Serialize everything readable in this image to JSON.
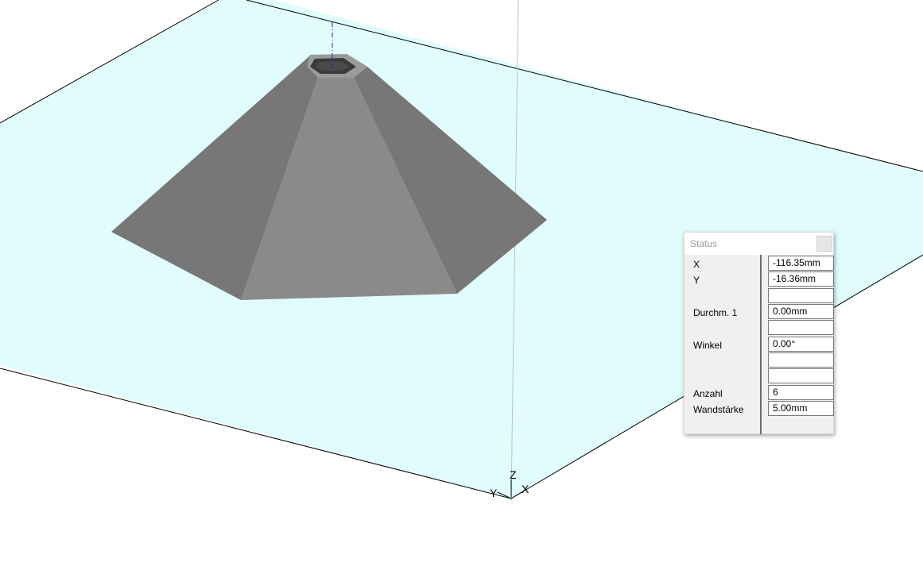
{
  "viewport": {
    "plane_color": "#e0fcfc",
    "axis_labels": {
      "x": "X",
      "y": "Y",
      "z": "Z"
    }
  },
  "status_panel": {
    "title": "Status",
    "rows": [
      {
        "label": "X",
        "value": "-116.35mm"
      },
      {
        "label": "Y",
        "value": "-16.36mm"
      },
      {
        "label": "",
        "value": ""
      },
      {
        "label": "Durchm. 1",
        "value": "0.00mm"
      },
      {
        "label": "",
        "value": ""
      },
      {
        "label": "Winkel",
        "value": "0.00°"
      },
      {
        "label": "",
        "value": ""
      },
      {
        "label": "",
        "value": ""
      },
      {
        "label": "Anzahl",
        "value": "6"
      },
      {
        "label": "Wandstärke",
        "value": "5.00mm"
      }
    ]
  }
}
